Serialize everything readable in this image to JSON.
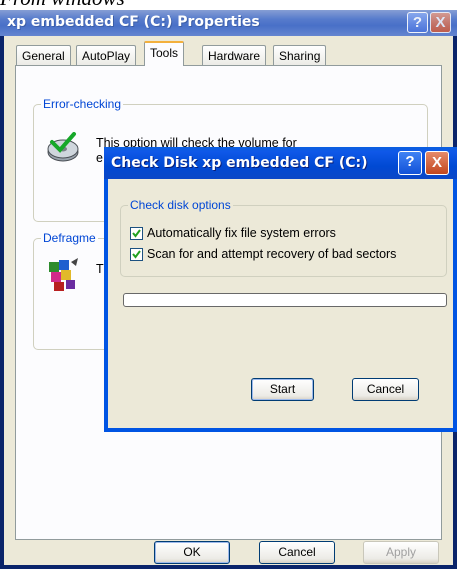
{
  "caption": "From windows",
  "properties_window": {
    "title": "xp embedded CF (C:) Properties",
    "help_glyph": "?",
    "close_glyph": "X",
    "tabs": [
      {
        "label": "General",
        "active": false
      },
      {
        "label": "AutoPlay",
        "active": false
      },
      {
        "label": "Tools",
        "active": true
      },
      {
        "label": "Hardware",
        "active": false
      },
      {
        "label": "Sharing",
        "active": false
      }
    ],
    "error_checking": {
      "label": "Error-checking",
      "text_line1": "This option will check the volume for",
      "text_line2": "e",
      "icon": "disk-check-icon"
    },
    "defrag": {
      "label": "Defragme",
      "text": "T",
      "icon": "defrag-icon"
    },
    "buttons": {
      "ok": "OK",
      "cancel": "Cancel",
      "apply": "Apply"
    }
  },
  "check_disk_dialog": {
    "title": "Check Disk xp embedded CF (C:)",
    "help_glyph": "?",
    "close_glyph": "X",
    "options_label": "Check disk options",
    "option1": {
      "label": "Automatically fix file system errors",
      "checked": true
    },
    "option2": {
      "label": "Scan for and attempt recovery of bad sectors",
      "checked": true
    },
    "progress": 0,
    "start_label": "Start",
    "cancel_label": "Cancel"
  },
  "colors": {
    "accent": "#0054e3",
    "group_label": "#0046d5",
    "tab_highlight": "#f3b03c"
  }
}
